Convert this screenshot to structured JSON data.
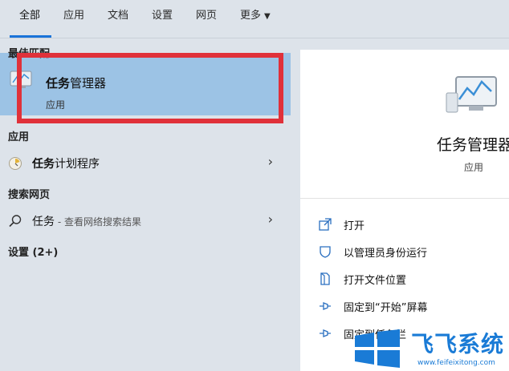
{
  "tabs": [
    {
      "label": "全部"
    },
    {
      "label": "应用"
    },
    {
      "label": "文档"
    },
    {
      "label": "设置"
    },
    {
      "label": "网页"
    },
    {
      "label": "更多"
    }
  ],
  "sections": {
    "best_match": "最佳匹配",
    "apps": "应用",
    "web": "搜索网页",
    "settings": "设置 (2+)"
  },
  "best_match": {
    "title_bold": "任务",
    "title_rest": "管理器",
    "subtitle": "应用",
    "icon": "task-manager-icon"
  },
  "apps": [
    {
      "bold": "任务",
      "rest": "计划程序",
      "icon": "task-scheduler-icon"
    }
  ],
  "web": [
    {
      "query": "任务",
      "suffix": " - 查看网络搜索结果",
      "icon": "search-icon"
    }
  ],
  "detail": {
    "title": "任务管理器",
    "subtitle": "应用",
    "actions": [
      {
        "label": "打开",
        "icon": "open-icon"
      },
      {
        "label": "以管理员身份运行",
        "icon": "shield-icon"
      },
      {
        "label": "打开文件位置",
        "icon": "file-location-icon"
      },
      {
        "label": "固定到“开始”屏幕",
        "icon": "pin-icon"
      },
      {
        "label": "固定到任务栏",
        "icon": "pin-icon"
      }
    ]
  },
  "watermark": {
    "text": "飞飞系统",
    "url": "www.feifeixitong.com"
  },
  "colors": {
    "accent": "#1a73d9",
    "highlight": "#9cc3e5",
    "annotation": "#e0313a",
    "watermark": "#1a7bd6"
  }
}
